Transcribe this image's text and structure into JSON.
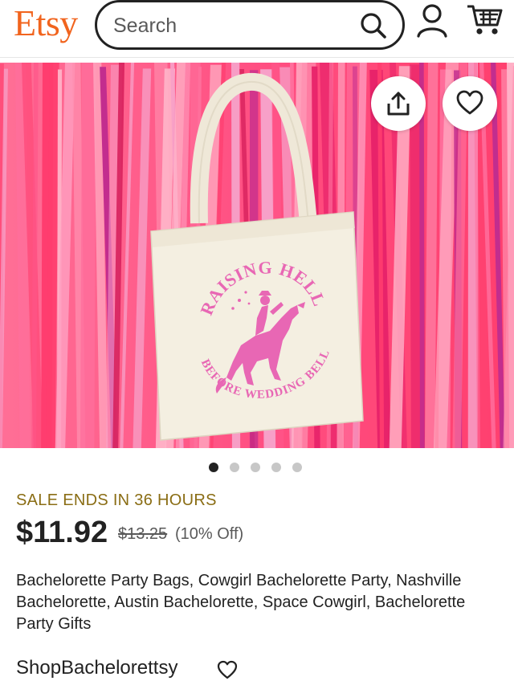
{
  "header": {
    "logo": "Etsy",
    "search_placeholder": "Search",
    "icons": [
      "search-icon",
      "user-icon",
      "cart-icon"
    ]
  },
  "hero": {
    "image_desc": "Cream tote bag with pink horse rider print on pink tinsel backdrop",
    "print_top_text": "RAISING HELL",
    "print_bottom_text": "BEFORE WEDDING BELLS",
    "actions": [
      "share-icon",
      "heart-icon"
    ],
    "carousel": {
      "count": 5,
      "active_index": 0
    }
  },
  "listing": {
    "sale_notice": "SALE ENDS IN 36 HOURS",
    "price": "$11.92",
    "original_price": "$13.25",
    "discount": "(10% Off)",
    "title": "Bachelorette Party Bags, Cowgirl Bachelorette Party, Nashville Bachelorette, Austin Bachelorette, Space Cowgirl, Bachelorette Party Gifts",
    "shop_name": "ShopBachelorettsy"
  },
  "colors": {
    "brand": "#f1641e",
    "sale_text": "#8a6d14",
    "print_pink": "#e867b4",
    "backdrop_pink": "#ff5a8a"
  }
}
